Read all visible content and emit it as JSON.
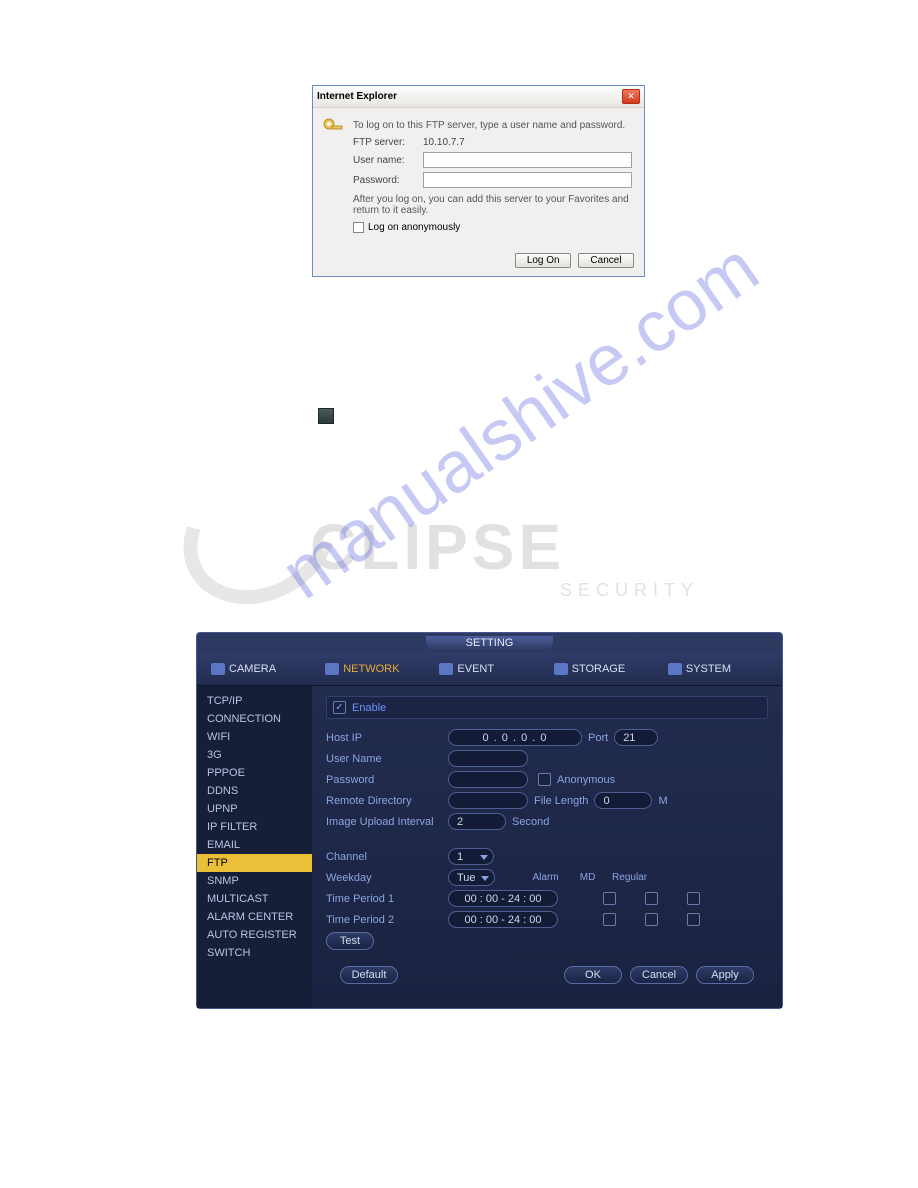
{
  "watermark": {
    "url_text": "manualshive.com",
    "brand": "CLIPSE",
    "sub": "SECURITY"
  },
  "ie_dialog": {
    "title": "Internet Explorer",
    "msg": "To log on to this FTP server, type a user name and password.",
    "server_label": "FTP server:",
    "server_value": "10.10.7.7",
    "user_label": "User name:",
    "pass_label": "Password:",
    "hint": "After you log on, you can add this server to your Favorites and return to it easily.",
    "anon_label": "Log on anonymously",
    "logon_btn": "Log On",
    "cancel_btn": "Cancel"
  },
  "dvr": {
    "title": "SETTING",
    "nav": {
      "camera": "CAMERA",
      "network": "NETWORK",
      "event": "EVENT",
      "storage": "STORAGE",
      "system": "SYSTEM"
    },
    "side": {
      "tcpip": "TCP/IP",
      "connection": "CONNECTION",
      "wifi": "WIFI",
      "g3": "3G",
      "pppoe": "PPPOE",
      "ddns": "DDNS",
      "upnp": "UPNP",
      "ipfilter": "IP FILTER",
      "email": "EMAIL",
      "ftp": "FTP",
      "snmp": "SNMP",
      "multicast": "MULTICAST",
      "alarmcenter": "ALARM CENTER",
      "autoregister": "AUTO REGISTER",
      "switch": "SWITCH"
    },
    "form": {
      "enable": "Enable",
      "hostip_label": "Host IP",
      "hostip_value": "0  .   0  .   0  .   0",
      "port_label": "Port",
      "port_value": "21",
      "user_label": "User Name",
      "pass_label": "Password",
      "anon_label": "Anonymous",
      "remotedir_label": "Remote Directory",
      "filelen_label": "File Length",
      "filelen_value": "0",
      "filelen_unit": "M",
      "imgint_label": "Image Upload Interval",
      "imgint_value": "2",
      "imgint_unit": "Second",
      "channel_label": "Channel",
      "channel_value": "1",
      "weekday_label": "Weekday",
      "weekday_value": "Tue",
      "hdr_alarm": "Alarm",
      "hdr_md": "MD",
      "hdr_regular": "Regular",
      "tp1_label": "Time Period 1",
      "tp1_value": "00 : 00      - 24 : 00",
      "tp2_label": "Time Period 2",
      "tp2_value": "00 : 00      - 24 : 00",
      "test_btn": "Test"
    },
    "footer": {
      "default": "Default",
      "ok": "OK",
      "cancel": "Cancel",
      "apply": "Apply"
    }
  }
}
